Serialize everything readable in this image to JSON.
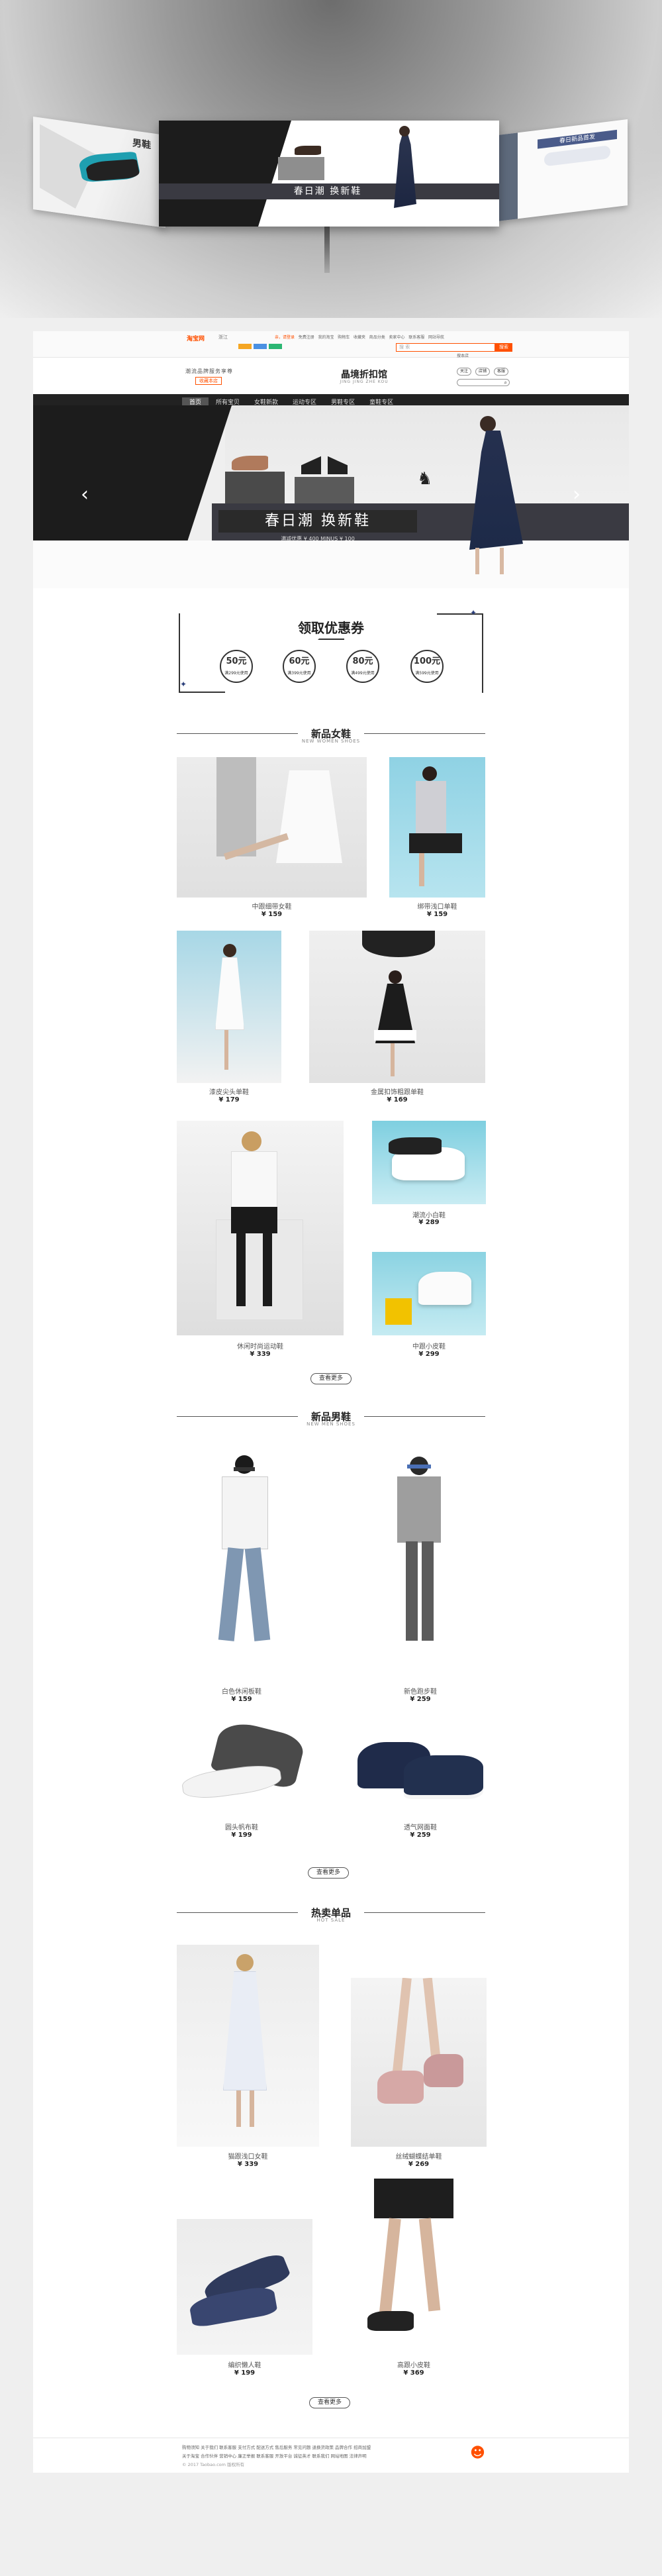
{
  "hero": {
    "headline": "春日潮  换新鞋",
    "right_panel_title": "春日新品首发",
    "left_panel_text": "男鞋"
  },
  "topbar": {
    "logo": "淘宝网",
    "city": "浙江",
    "links": [
      "亲，请登录",
      "免费注册",
      "我的淘宝",
      "购物车",
      "收藏夹",
      "商品分类",
      "卖家中心",
      "联系客服",
      "网站导航"
    ],
    "search_placeholder": "搜 索",
    "search_button": "搜索",
    "search_alt": "搜本店"
  },
  "shop": {
    "left_slogan": "潮流品牌服务享尊",
    "follow_button": "收藏本店",
    "shop_name": "晶境折扣馆",
    "shop_name_en": "JING JING ZHE KOU",
    "right_buttons": [
      "关注",
      "店铺",
      "客服",
      "收藏"
    ]
  },
  "nav": {
    "items": [
      "首页",
      "所有宝贝",
      "女鞋新款",
      "运动专区",
      "男鞋专区",
      "童鞋专区"
    ]
  },
  "banner": {
    "title": "春日潮  换新鞋",
    "subtitle": "满减优惠 ¥ 400 MINUS ¥ 100",
    "prev": "‹",
    "next": "›"
  },
  "coupons": {
    "title": "领取优惠券",
    "items": [
      {
        "amount": "50元",
        "condition": "满299元使用"
      },
      {
        "amount": "60元",
        "condition": "满399元使用"
      },
      {
        "amount": "80元",
        "condition": "满499元使用"
      },
      {
        "amount": "100元",
        "condition": "满599元使用"
      }
    ]
  },
  "sections": {
    "women": {
      "title": "新品女鞋",
      "subtitle": "NEW WOMEN SHOES",
      "more": "查看更多",
      "products": [
        {
          "name": "中跟细带女鞋",
          "price": "¥ 159"
        },
        {
          "name": "绑带浅口单鞋",
          "price": "¥ 159"
        },
        {
          "name": "漆皮尖头单鞋",
          "price": "¥ 179"
        },
        {
          "name": "金属扣饰粗跟单鞋",
          "price": "¥ 169"
        },
        {
          "name": "潮流小白鞋",
          "price": "¥ 289"
        },
        {
          "name": "休闲时尚运动鞋",
          "price": "¥ 339"
        },
        {
          "name": "中跟小皮鞋",
          "price": "¥ 299"
        }
      ]
    },
    "men": {
      "title": "新品男鞋",
      "subtitle": "NEW MEN SHOES",
      "more": "查看更多",
      "products": [
        {
          "name": "白色休闲板鞋",
          "price": "¥ 159"
        },
        {
          "name": "新色跑步鞋",
          "price": "¥ 259"
        },
        {
          "name": "圆头帆布鞋",
          "price": "¥ 199"
        },
        {
          "name": "透气网面鞋",
          "price": "¥ 259"
        }
      ]
    },
    "hot": {
      "title": "热卖单品",
      "subtitle": "HOT SALE",
      "more": "查看更多",
      "products": [
        {
          "name": "猫跟浅口女鞋",
          "price": "¥ 339"
        },
        {
          "name": "丝绒蝴蝶结单鞋",
          "price": "¥ 269"
        },
        {
          "name": "编织懒人鞋",
          "price": "¥ 199"
        },
        {
          "name": "高跟小皮鞋",
          "price": "¥ 369"
        }
      ]
    }
  },
  "footer": {
    "line1": "购物须知 关于我们 联系客服 支付方式 配送方式 售后服务 常见问题 退换货政策 品牌合作 招商加盟",
    "line2": "关于淘宝 合作伙伴 营销中心 廉正举报 联系客服 开放平台 诚征英才 联系我们 网站地图 法律声明",
    "copyright": "© 2017 Taobao.com 版权所有"
  },
  "colors": {
    "accent": "#ff5000",
    "dark": "#222222",
    "nav": "#222222",
    "banner_strip": "#3a3a42"
  }
}
